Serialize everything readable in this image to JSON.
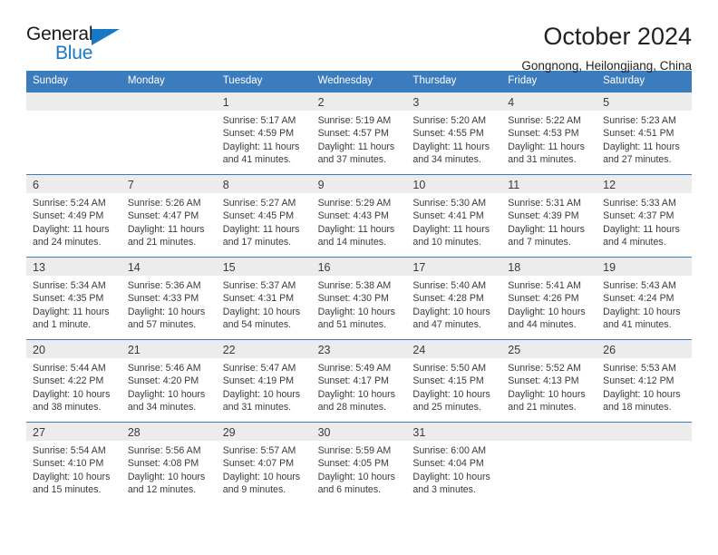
{
  "brand": {
    "name_dark": "General",
    "name_blue": "Blue",
    "triangle_icon": "triangle-icon",
    "accent_color": "#1878c8"
  },
  "header": {
    "title": "October 2024",
    "subtitle": "Gongnong, Heilongjiang, China"
  },
  "theme": {
    "header_blue": "#3b7cbf",
    "daynum_band": "#ececec",
    "text": "#3a3a3a"
  },
  "weekdays": [
    "Sunday",
    "Monday",
    "Tuesday",
    "Wednesday",
    "Thursday",
    "Friday",
    "Saturday"
  ],
  "weeks": [
    [
      {
        "day": "",
        "sunrise": "",
        "sunset": "",
        "daylight": ""
      },
      {
        "day": "",
        "sunrise": "",
        "sunset": "",
        "daylight": ""
      },
      {
        "day": "1",
        "sunrise": "Sunrise: 5:17 AM",
        "sunset": "Sunset: 4:59 PM",
        "daylight": "Daylight: 11 hours and 41 minutes."
      },
      {
        "day": "2",
        "sunrise": "Sunrise: 5:19 AM",
        "sunset": "Sunset: 4:57 PM",
        "daylight": "Daylight: 11 hours and 37 minutes."
      },
      {
        "day": "3",
        "sunrise": "Sunrise: 5:20 AM",
        "sunset": "Sunset: 4:55 PM",
        "daylight": "Daylight: 11 hours and 34 minutes."
      },
      {
        "day": "4",
        "sunrise": "Sunrise: 5:22 AM",
        "sunset": "Sunset: 4:53 PM",
        "daylight": "Daylight: 11 hours and 31 minutes."
      },
      {
        "day": "5",
        "sunrise": "Sunrise: 5:23 AM",
        "sunset": "Sunset: 4:51 PM",
        "daylight": "Daylight: 11 hours and 27 minutes."
      }
    ],
    [
      {
        "day": "6",
        "sunrise": "Sunrise: 5:24 AM",
        "sunset": "Sunset: 4:49 PM",
        "daylight": "Daylight: 11 hours and 24 minutes."
      },
      {
        "day": "7",
        "sunrise": "Sunrise: 5:26 AM",
        "sunset": "Sunset: 4:47 PM",
        "daylight": "Daylight: 11 hours and 21 minutes."
      },
      {
        "day": "8",
        "sunrise": "Sunrise: 5:27 AM",
        "sunset": "Sunset: 4:45 PM",
        "daylight": "Daylight: 11 hours and 17 minutes."
      },
      {
        "day": "9",
        "sunrise": "Sunrise: 5:29 AM",
        "sunset": "Sunset: 4:43 PM",
        "daylight": "Daylight: 11 hours and 14 minutes."
      },
      {
        "day": "10",
        "sunrise": "Sunrise: 5:30 AM",
        "sunset": "Sunset: 4:41 PM",
        "daylight": "Daylight: 11 hours and 10 minutes."
      },
      {
        "day": "11",
        "sunrise": "Sunrise: 5:31 AM",
        "sunset": "Sunset: 4:39 PM",
        "daylight": "Daylight: 11 hours and 7 minutes."
      },
      {
        "day": "12",
        "sunrise": "Sunrise: 5:33 AM",
        "sunset": "Sunset: 4:37 PM",
        "daylight": "Daylight: 11 hours and 4 minutes."
      }
    ],
    [
      {
        "day": "13",
        "sunrise": "Sunrise: 5:34 AM",
        "sunset": "Sunset: 4:35 PM",
        "daylight": "Daylight: 11 hours and 1 minute."
      },
      {
        "day": "14",
        "sunrise": "Sunrise: 5:36 AM",
        "sunset": "Sunset: 4:33 PM",
        "daylight": "Daylight: 10 hours and 57 minutes."
      },
      {
        "day": "15",
        "sunrise": "Sunrise: 5:37 AM",
        "sunset": "Sunset: 4:31 PM",
        "daylight": "Daylight: 10 hours and 54 minutes."
      },
      {
        "day": "16",
        "sunrise": "Sunrise: 5:38 AM",
        "sunset": "Sunset: 4:30 PM",
        "daylight": "Daylight: 10 hours and 51 minutes."
      },
      {
        "day": "17",
        "sunrise": "Sunrise: 5:40 AM",
        "sunset": "Sunset: 4:28 PM",
        "daylight": "Daylight: 10 hours and 47 minutes."
      },
      {
        "day": "18",
        "sunrise": "Sunrise: 5:41 AM",
        "sunset": "Sunset: 4:26 PM",
        "daylight": "Daylight: 10 hours and 44 minutes."
      },
      {
        "day": "19",
        "sunrise": "Sunrise: 5:43 AM",
        "sunset": "Sunset: 4:24 PM",
        "daylight": "Daylight: 10 hours and 41 minutes."
      }
    ],
    [
      {
        "day": "20",
        "sunrise": "Sunrise: 5:44 AM",
        "sunset": "Sunset: 4:22 PM",
        "daylight": "Daylight: 10 hours and 38 minutes."
      },
      {
        "day": "21",
        "sunrise": "Sunrise: 5:46 AM",
        "sunset": "Sunset: 4:20 PM",
        "daylight": "Daylight: 10 hours and 34 minutes."
      },
      {
        "day": "22",
        "sunrise": "Sunrise: 5:47 AM",
        "sunset": "Sunset: 4:19 PM",
        "daylight": "Daylight: 10 hours and 31 minutes."
      },
      {
        "day": "23",
        "sunrise": "Sunrise: 5:49 AM",
        "sunset": "Sunset: 4:17 PM",
        "daylight": "Daylight: 10 hours and 28 minutes."
      },
      {
        "day": "24",
        "sunrise": "Sunrise: 5:50 AM",
        "sunset": "Sunset: 4:15 PM",
        "daylight": "Daylight: 10 hours and 25 minutes."
      },
      {
        "day": "25",
        "sunrise": "Sunrise: 5:52 AM",
        "sunset": "Sunset: 4:13 PM",
        "daylight": "Daylight: 10 hours and 21 minutes."
      },
      {
        "day": "26",
        "sunrise": "Sunrise: 5:53 AM",
        "sunset": "Sunset: 4:12 PM",
        "daylight": "Daylight: 10 hours and 18 minutes."
      }
    ],
    [
      {
        "day": "27",
        "sunrise": "Sunrise: 5:54 AM",
        "sunset": "Sunset: 4:10 PM",
        "daylight": "Daylight: 10 hours and 15 minutes."
      },
      {
        "day": "28",
        "sunrise": "Sunrise: 5:56 AM",
        "sunset": "Sunset: 4:08 PM",
        "daylight": "Daylight: 10 hours and 12 minutes."
      },
      {
        "day": "29",
        "sunrise": "Sunrise: 5:57 AM",
        "sunset": "Sunset: 4:07 PM",
        "daylight": "Daylight: 10 hours and 9 minutes."
      },
      {
        "day": "30",
        "sunrise": "Sunrise: 5:59 AM",
        "sunset": "Sunset: 4:05 PM",
        "daylight": "Daylight: 10 hours and 6 minutes."
      },
      {
        "day": "31",
        "sunrise": "Sunrise: 6:00 AM",
        "sunset": "Sunset: 4:04 PM",
        "daylight": "Daylight: 10 hours and 3 minutes."
      },
      {
        "day": "",
        "sunrise": "",
        "sunset": "",
        "daylight": ""
      },
      {
        "day": "",
        "sunrise": "",
        "sunset": "",
        "daylight": ""
      }
    ]
  ]
}
